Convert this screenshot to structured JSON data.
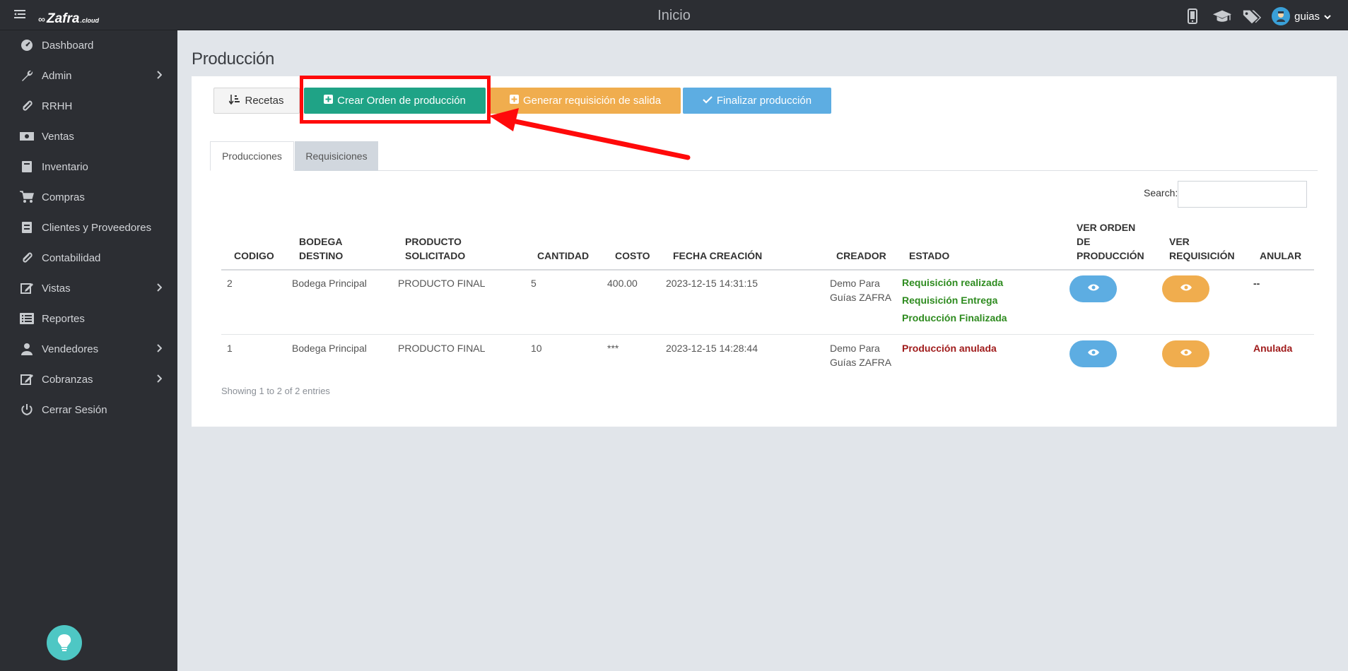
{
  "topbar": {
    "logo_main": "Zafra",
    "logo_suffix": ".cloud",
    "title": "Inicio",
    "icons": [
      "mobile-icon",
      "graduation-cap-icon",
      "tags-icon"
    ],
    "user_name": "guias"
  },
  "sidebar": {
    "items": [
      {
        "label": "Dashboard",
        "icon": "dashboard-icon",
        "has_submenu": false
      },
      {
        "label": "Admin",
        "icon": "wrench-icon",
        "has_submenu": true
      },
      {
        "label": "RRHH",
        "icon": "paperclip-icon",
        "has_submenu": false
      },
      {
        "label": "Ventas",
        "icon": "money-icon",
        "has_submenu": false
      },
      {
        "label": "Inventario",
        "icon": "book-icon",
        "has_submenu": false
      },
      {
        "label": "Compras",
        "icon": "cart-icon",
        "has_submenu": false
      },
      {
        "label": "Clientes y Proveedores",
        "icon": "address-book-icon",
        "has_submenu": false
      },
      {
        "label": "Contabilidad",
        "icon": "paperclip-icon",
        "has_submenu": false
      },
      {
        "label": "Vistas",
        "icon": "edit-icon",
        "has_submenu": true
      },
      {
        "label": "Reportes",
        "icon": "list-icon",
        "has_submenu": false
      },
      {
        "label": "Vendedores",
        "icon": "user-icon",
        "has_submenu": true
      },
      {
        "label": "Cobranzas",
        "icon": "edit-icon",
        "has_submenu": true
      },
      {
        "label": "Cerrar Sesión",
        "icon": "power-icon",
        "has_submenu": false
      }
    ]
  },
  "page": {
    "title": "Producción"
  },
  "toolbar": {
    "recetas": "Recetas",
    "crear": "Crear Orden de producción",
    "generar": "Generar requisición de salida",
    "finalizar": "Finalizar producción"
  },
  "tabs": {
    "producciones": "Producciones",
    "requisiciones": "Requisiciones"
  },
  "search": {
    "label": "Search:",
    "placeholder": ""
  },
  "table": {
    "headers": {
      "codigo": "CODIGO",
      "bodega_1": "BODEGA",
      "bodega_2": "DESTINO",
      "producto_1": "PRODUCTO",
      "producto_2": "SOLICITADO",
      "cantidad": "CANTIDAD",
      "costo": "COSTO",
      "fecha": "FECHA CREACIÓN",
      "creador": "CREADOR",
      "estado": "ESTADO",
      "ver_orden_1": "VER ORDEN",
      "ver_orden_2": "DE",
      "ver_orden_3": "PRODUCCIÓN",
      "ver_req_1": "VER",
      "ver_req_2": "REQUISICIÓN",
      "anular": "ANULAR"
    },
    "rows": [
      {
        "codigo": "2",
        "bodega": "Bodega Principal",
        "producto": "PRODUCTO FINAL",
        "cantidad": "5",
        "costo": "400.00",
        "fecha": "2023-12-15 14:31:15",
        "creador_1": "Demo Para",
        "creador_2": "Guías ZAFRA",
        "estado": [
          "Requisición realizada",
          "Requisición Entrega",
          "Producción Finalizada"
        ],
        "anular": "--"
      },
      {
        "codigo": "1",
        "bodega": "Bodega Principal",
        "producto": "PRODUCTO FINAL",
        "cantidad": "10",
        "costo": "***",
        "fecha": "2023-12-15 14:28:44",
        "creador_1": "Demo Para",
        "creador_2": "Guías ZAFRA",
        "estado": [
          "Producción anulada"
        ],
        "anular": "Anulada"
      }
    ],
    "footer": "Showing 1 to 2 of 2 entries"
  },
  "colors": {
    "sidebar_bg": "#2c2e33",
    "content_bg": "#e1e5ea",
    "green_button": "#1fa386",
    "orange_button": "#f0ad4e",
    "blue_button": "#5dade2",
    "status_ok": "#2e8b1f",
    "status_cancelled": "#a01c1c",
    "highlight": "#ff0a0a"
  }
}
